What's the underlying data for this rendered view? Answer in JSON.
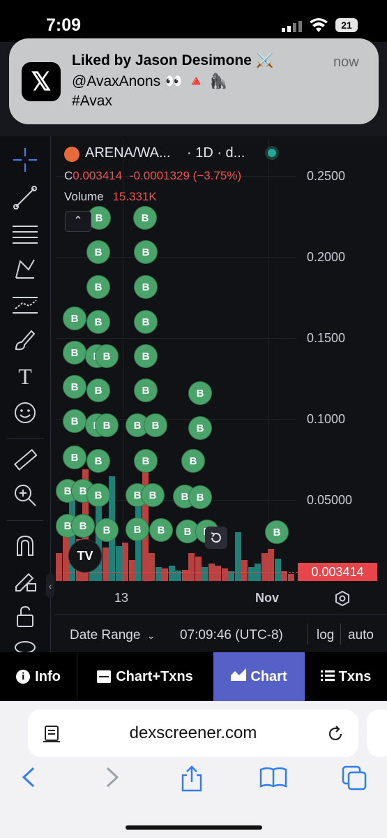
{
  "status_bar": {
    "time": "7:09",
    "battery": "21"
  },
  "notification": {
    "app_icon": "x-logo-icon",
    "title": "Liked by Jason Desimone ⚔️",
    "time": "now",
    "line1": "@AvaxAnons 👀 🔺 🦍",
    "line2": "#Avax"
  },
  "chart": {
    "pair": "ARENA/WA...",
    "interval": "· 1D · d...",
    "close_prefix": "C",
    "close": "0.003414",
    "change": "-0.0001329 (−3.75%)",
    "volume_label": "Volume",
    "volume_value": "15.331K",
    "price_ticks": [
      "0.2500",
      "0.2000",
      "0.1500",
      "0.1000",
      "0.05000"
    ],
    "current_price": "0.003414",
    "x_ticks": [
      "13",
      "Nov"
    ],
    "buy_marker": "B",
    "watermark": "TV",
    "reset_icon": "reset-icon",
    "settings_icon": "gear-icon",
    "colors": {
      "up": "#26a69a",
      "down": "#ef5350",
      "buy": "#4aa36a",
      "price_tag": "#e8454a"
    }
  },
  "chart_controls": {
    "date_range": "Date Range",
    "clock": "07:09:46 (UTC-8)",
    "log": "log",
    "auto": "auto"
  },
  "tabs": [
    {
      "label": "Info",
      "icon": "info-icon"
    },
    {
      "label": "Chart+Txns",
      "icon": "split-view-icon"
    },
    {
      "label": "Chart",
      "icon": "chart-icon",
      "active": true
    },
    {
      "label": "Txns",
      "icon": "list-icon"
    }
  ],
  "browser": {
    "url": "dexscreener.com"
  }
}
